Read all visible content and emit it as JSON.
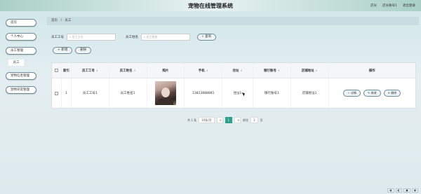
{
  "header": {
    "app_title": "宠物在线管理系统",
    "role_label": "店长",
    "account_label": "店长账号1",
    "logout_label": "退出登录"
  },
  "sidebar": {
    "items": [
      {
        "label": "首页"
      },
      {
        "label": "个人中心"
      },
      {
        "label": "员工管理"
      },
      {
        "label": "员工"
      },
      {
        "label": "宠物信息管理"
      },
      {
        "label": "宠物日常管理"
      }
    ]
  },
  "breadcrumb": {
    "home": "首页",
    "sep": "/",
    "current": "员工"
  },
  "search": {
    "field1_label": "员工工号",
    "field1_placeholder": "员工工号",
    "field2_label": "员工姓名",
    "field2_placeholder": "员工姓名",
    "query_label": "查询"
  },
  "actions": {
    "add_label": "+ 新增",
    "delete_label": "删除"
  },
  "table": {
    "columns": [
      "",
      "索引",
      "员工工号",
      "员工姓名",
      "照片",
      "手机",
      "住址",
      "银行账号",
      "店铺地址",
      "操作"
    ],
    "rows": [
      {
        "no": "1",
        "id": "员工工号1",
        "name": "员工姓名1",
        "phone": "13823888881",
        "address": "住址1",
        "card": "银行账号1",
        "shop": "店铺地址1"
      }
    ],
    "op_detail": "详情",
    "op_edit": "修改",
    "op_delete": "删除"
  },
  "pager": {
    "total": "共 1 条",
    "page_size": "10条/页",
    "prev": "<",
    "page": "1",
    "next": ">",
    "goto_label": "前往",
    "goto_value": "1",
    "page_suffix": "页"
  },
  "colors": {
    "accent": "#2fa08a",
    "border": "#6a8a96"
  }
}
